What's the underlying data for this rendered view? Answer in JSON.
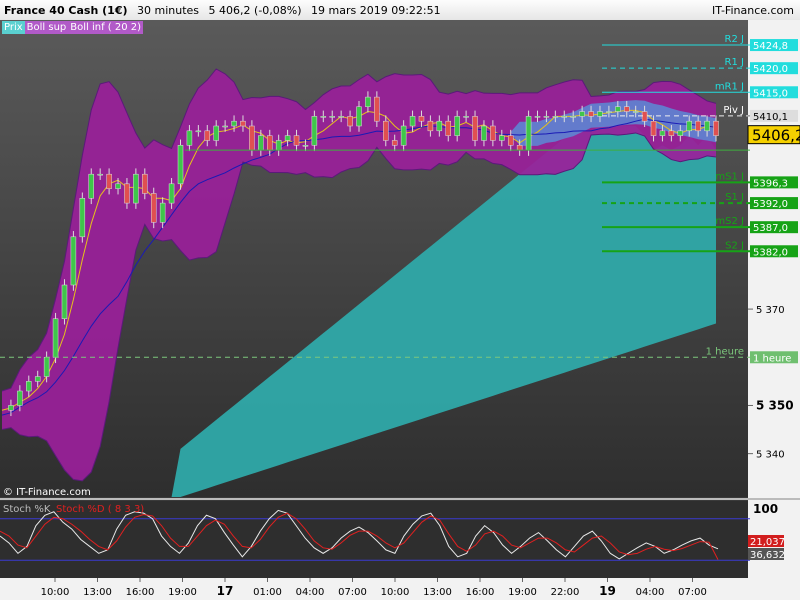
{
  "header": {
    "instrument": "France 40 Cash (1€)",
    "timeframe": "30 minutes",
    "quote": "5 406,2 (-0,08%)",
    "datetime": "19 mars 2019 09:22:51",
    "brand": "IT-Finance.com"
  },
  "legend": {
    "price": "Prix",
    "boll_sup": "Boll sup",
    "boll_inf": "Boll inf ( 20 2)"
  },
  "watermark": "© IT-Finance.com",
  "stoch_legend": {
    "k": "Stoch %K",
    "d": "Stoch %D ( 8 3 3)"
  },
  "colors": {
    "background": "#3a3a3a",
    "bollinger_fill": "#9a1f9a",
    "cloud_teal": "#2fa9a9",
    "cloud_blue": "#5b8bd6",
    "up_candle": "#3fc64a",
    "down_candle": "#e05050",
    "ma_yellow": "#e6c21a",
    "line_blue": "#1a1ab5",
    "resistance": "#22dddd",
    "support": "#16a316",
    "stoch_k": "#e8e8e8",
    "stoch_d": "#e02020"
  },
  "chart_data": [
    {
      "type": "candlestick",
      "title": "France 40 Cash (1€) 30 minutes",
      "x_tick_labels": [
        "10:00",
        "13:00",
        "16:00",
        "19:00",
        "17",
        "01:00",
        "04:00",
        "07:00",
        "10:00",
        "13:00",
        "16:00",
        "19:00",
        "22:00",
        "19",
        "04:00",
        "07:00"
      ],
      "y_tick_labels": [
        "5 340",
        "5 350",
        "5 370",
        "5 410,1"
      ],
      "ylim": [
        5331,
        5430
      ],
      "grid": false,
      "last_price": 5406.2,
      "levels": [
        {
          "label": "R2 J",
          "value": 5424.8,
          "style": "solid",
          "kind": "resistance"
        },
        {
          "label": "R1 J",
          "value": 5420.0,
          "style": "dashed",
          "kind": "resistance"
        },
        {
          "label": "mR1 J",
          "value": 5415.0,
          "style": "solid",
          "kind": "resistance"
        },
        {
          "label": "Piv J",
          "value": 5410.1,
          "style": "dashed",
          "kind": "pivot"
        },
        {
          "label": "mS1 J",
          "value": 5396.3,
          "style": "solid",
          "kind": "support"
        },
        {
          "label": "S1 J",
          "value": 5392.0,
          "style": "dashed",
          "kind": "support"
        },
        {
          "label": "mS2 J",
          "value": 5387.0,
          "style": "solid",
          "kind": "support"
        },
        {
          "label": "S2 J",
          "value": 5382.0,
          "style": "solid",
          "kind": "support"
        },
        {
          "label": "1 heure",
          "value": 5360.0,
          "style": "dashed",
          "kind": "timeframe"
        }
      ],
      "close_series": [
        5349,
        5350,
        5353,
        5355,
        5356,
        5360,
        5368,
        5375,
        5385,
        5393,
        5398,
        5398,
        5395,
        5396,
        5392,
        5398,
        5394,
        5388,
        5392,
        5396,
        5404,
        5407,
        5407,
        5405,
        5408,
        5408,
        5409,
        5408,
        5403,
        5406,
        5403,
        5405,
        5406,
        5404,
        5404,
        5410,
        5410,
        5410,
        5410,
        5408,
        5412,
        5414,
        5409,
        5405,
        5404,
        5408,
        5410,
        5409,
        5407,
        5409,
        5406,
        5410,
        5410,
        5405,
        5408,
        5405,
        5406,
        5404,
        5403,
        5410,
        5410,
        5410,
        5410,
        5410,
        5410,
        5411,
        5410,
        5411,
        5411,
        5412,
        5411,
        5411,
        5409,
        5406,
        5407,
        5406,
        5407,
        5409,
        5407,
        5409,
        5406
      ]
    },
    {
      "type": "line",
      "title": "Stoch %K / Stoch %D ( 8 3 3)",
      "y_tick_labels": [
        "100"
      ],
      "ylim": [
        0,
        100
      ],
      "levels": [
        80,
        20
      ],
      "last_values": {
        "d": "21,037",
        "k": "36,632"
      },
      "series": [
        {
          "name": "Stoch %K",
          "values": [
            55,
            45,
            30,
            40,
            70,
            85,
            90,
            75,
            65,
            50,
            40,
            30,
            35,
            65,
            85,
            90,
            88,
            80,
            55,
            40,
            30,
            45,
            70,
            85,
            80,
            60,
            42,
            25,
            40,
            62,
            80,
            92,
            88,
            70,
            52,
            38,
            30,
            38,
            52,
            62,
            68,
            60,
            48,
            35,
            30,
            55,
            72,
            84,
            88,
            70,
            40,
            25,
            30,
            55,
            70,
            60,
            42,
            30,
            40,
            52,
            60,
            48,
            35,
            25,
            40,
            55,
            62,
            48,
            30,
            22,
            30,
            38,
            45,
            40,
            30,
            35,
            42,
            48,
            52,
            42,
            36.6
          ]
        },
        {
          "name": "Stoch %D ( 8 3 3)",
          "values": [
            62,
            55,
            42,
            38,
            55,
            72,
            82,
            80,
            72,
            62,
            50,
            40,
            35,
            48,
            68,
            82,
            86,
            84,
            70,
            52,
            40,
            40,
            55,
            70,
            78,
            72,
            55,
            40,
            38,
            50,
            68,
            82,
            88,
            80,
            65,
            48,
            38,
            36,
            45,
            56,
            62,
            62,
            55,
            45,
            38,
            45,
            60,
            75,
            84,
            78,
            58,
            40,
            33,
            42,
            58,
            62,
            55,
            42,
            38,
            45,
            52,
            52,
            45,
            35,
            32,
            42,
            52,
            55,
            45,
            32,
            28,
            30,
            36,
            40,
            36,
            34,
            37,
            42,
            47,
            46,
            21.0
          ]
        }
      ]
    }
  ]
}
